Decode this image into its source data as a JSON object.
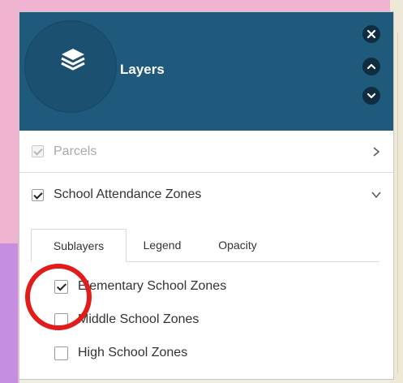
{
  "header": {
    "title": "Layers",
    "icon": "layers-icon",
    "color": "#1f5a7c",
    "buttons": [
      {
        "name": "close",
        "icon": "close-icon"
      },
      {
        "name": "collapse-up",
        "icon": "chevron-up-icon"
      },
      {
        "name": "collapse-down",
        "icon": "chevron-down-icon"
      }
    ]
  },
  "layers": [
    {
      "label": "Parcels",
      "checked": true,
      "disabled": true,
      "arrow": "chevron-right-icon"
    },
    {
      "label": "School Attendance Zones",
      "checked": true,
      "disabled": false,
      "arrow": "chevron-down-icon"
    }
  ],
  "tabs": [
    {
      "label": "Sublayers",
      "active": true
    },
    {
      "label": "Legend",
      "active": false
    },
    {
      "label": "Opacity",
      "active": false
    }
  ],
  "sublayers": [
    {
      "label": "Elementary School Zones",
      "checked": true
    },
    {
      "label": "Middle School Zones",
      "checked": false
    },
    {
      "label": "High School Zones",
      "checked": false
    }
  ],
  "annotation": {
    "color": "#e21b1b",
    "shape": "circle"
  }
}
